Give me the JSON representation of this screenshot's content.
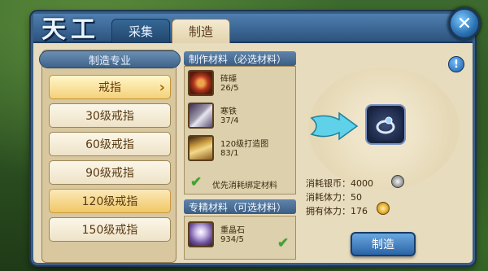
{
  "header": {
    "logo_text": "天工",
    "tabs": [
      {
        "label": "采集",
        "active": false
      },
      {
        "label": "制造",
        "active": true
      }
    ]
  },
  "specialty": {
    "title": "制造专业",
    "items": [
      {
        "label": "戒指",
        "selected": true
      },
      {
        "label": "30级戒指"
      },
      {
        "label": "60级戒指"
      },
      {
        "label": "90级戒指"
      },
      {
        "label": "120级戒指",
        "highlight": true
      },
      {
        "label": "150级戒指"
      }
    ]
  },
  "required_materials": {
    "title": "制作材料（必选材料）",
    "items": [
      {
        "name": "砗磲",
        "count": "26/5",
        "icon": "bead-bracelet-icon"
      },
      {
        "name": "寒铁",
        "count": "37/4",
        "icon": "iron-ingot-icon"
      },
      {
        "name": "120级打造图",
        "count": "83/1",
        "icon": "scroll-icon"
      }
    ],
    "prefer_bound_label": "优先消耗绑定材料"
  },
  "optional_materials": {
    "title": "专精材料（可选材料）",
    "items": [
      {
        "name": "重晶石",
        "count": "934/5",
        "icon": "crystal-icon"
      }
    ]
  },
  "costs": {
    "silver_label": "消耗银币：",
    "silver_value": "4000",
    "stamina_label": "消耗体力：",
    "stamina_value": "50",
    "owned_label": "拥有体力：",
    "owned_value": "176"
  },
  "craft_button": "制造",
  "colors": {
    "frame_blue": "#3a5f86",
    "parchment": "#e8dcbf",
    "check_green": "#3aa62a"
  }
}
